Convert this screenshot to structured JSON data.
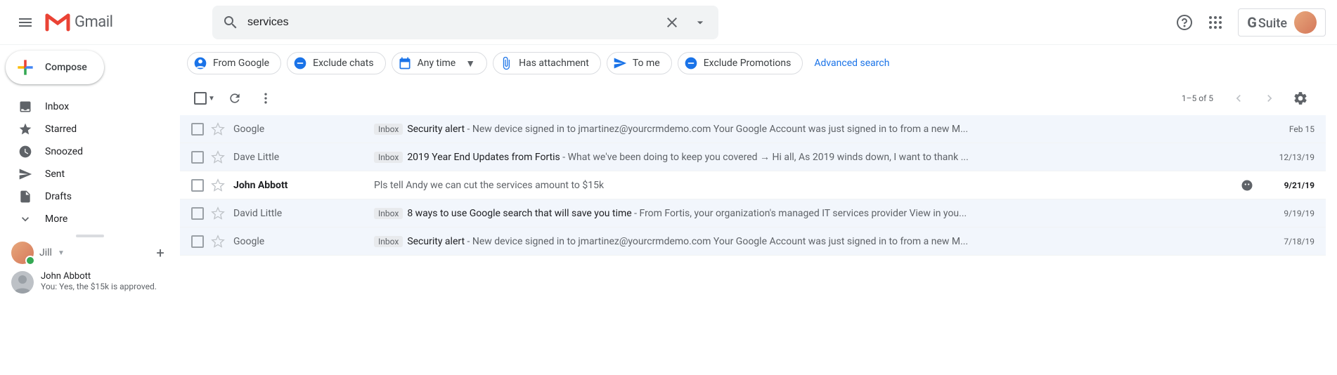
{
  "header": {
    "app_name": "Gmail",
    "search_value": "services",
    "gsuite_label": "Suite"
  },
  "compose_label": "Compose",
  "nav": [
    {
      "label": "Inbox",
      "icon": "inbox"
    },
    {
      "label": "Starred",
      "icon": "star"
    },
    {
      "label": "Snoozed",
      "icon": "clock"
    },
    {
      "label": "Sent",
      "icon": "send"
    },
    {
      "label": "Drafts",
      "icon": "file"
    },
    {
      "label": "More",
      "icon": "expand"
    }
  ],
  "hangouts": {
    "user": "Jill",
    "contact_name": "John Abbott",
    "contact_preview": "You: Yes, the $15k is approved."
  },
  "chips": [
    {
      "label": "From Google",
      "icon": "person-blue",
      "color": "#1a73e8"
    },
    {
      "label": "Exclude chats",
      "icon": "minus-blue",
      "color": "#1a73e8"
    },
    {
      "label": "Any time",
      "icon": "calendar-blue",
      "color": "#1a73e8",
      "caret": true
    },
    {
      "label": "Has attachment",
      "icon": "attach-blue",
      "color": "#1a73e8"
    },
    {
      "label": "To me",
      "icon": "send-blue",
      "color": "#1a73e8"
    },
    {
      "label": "Exclude Promotions",
      "icon": "minus-blue",
      "color": "#1a73e8"
    }
  ],
  "advanced_search_label": "Advanced search",
  "toolbar": {
    "count": "1–5 of 5"
  },
  "inbox_tag_label": "Inbox",
  "emails": [
    {
      "sender": "Google",
      "tag": true,
      "subject": "Security alert",
      "snippet": " - New device signed in to jmartinez@yourcrmdemo.com Your Google Account was just signed in to from a new M...",
      "date": "Feb 15",
      "attach": false,
      "unread": false
    },
    {
      "sender": "Dave Little",
      "tag": true,
      "subject": "2019 Year End Updates from Fortis",
      "snippet": " - What we've been doing to keep you covered → Hi all, As 2019 winds down, I want to thank ...",
      "date": "12/13/19",
      "attach": false,
      "unread": false
    },
    {
      "sender": "John Abbott",
      "tag": false,
      "subject": "",
      "snippet": "Pls tell Andy we can cut the services amount to $15k",
      "date": "9/21/19",
      "attach": true,
      "attach_icon": "github",
      "unread": true
    },
    {
      "sender": "David Little",
      "tag": true,
      "subject": "8 ways to use Google search that will save you time",
      "snippet": " - From Fortis, your organization's managed IT services provider View in you...",
      "date": "9/19/19",
      "attach": false,
      "unread": false
    },
    {
      "sender": "Google",
      "tag": true,
      "subject": "Security alert",
      "snippet": " - New device signed in to jmartinez@yourcrmdemo.com Your Google Account was just signed in to from a new M...",
      "date": "7/18/19",
      "attach": false,
      "unread": false
    }
  ]
}
